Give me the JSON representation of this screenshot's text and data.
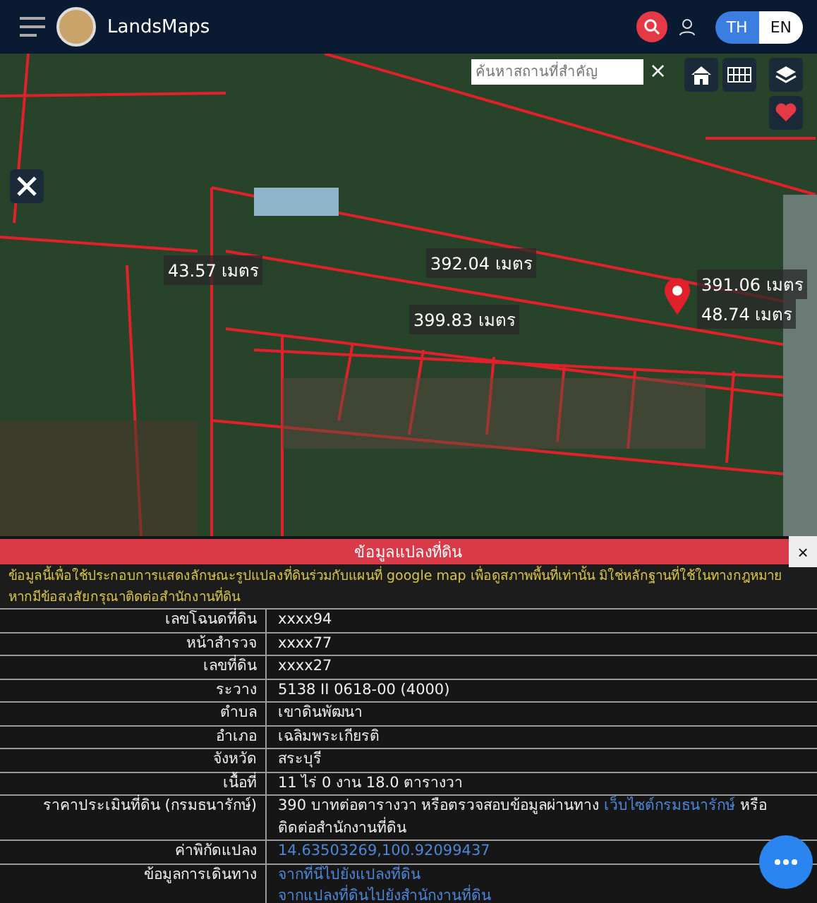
{
  "header": {
    "app_name": "LandsMaps",
    "languages": [
      {
        "label": "TH",
        "selected": true
      },
      {
        "label": "EN",
        "selected": false
      }
    ]
  },
  "map": {
    "search": {
      "placeholder": "ค้นหาสถานที่สำคัญ"
    },
    "close": "×",
    "measurements": [
      {
        "text": "43.57 เมตร"
      },
      {
        "text": "392.04 เมตร"
      },
      {
        "text": "399.83 เมตร"
      },
      {
        "text": "391.06 เมตร"
      },
      {
        "text": "48.74 เมตร"
      }
    ]
  },
  "panel": {
    "title": "ข้อมูลแปลงที่ดิน",
    "close": "×",
    "disclaimer": "ข้อมูลนี้เพื่อใช้ประกอบการแสดงลักษณะรูปแปลงที่ดินร่วมกับแผนที่ google map เพื่อดูสภาพพื้นที่เท่านั้น มิใช่หลักฐานที่ใช้ในทางกฎหมาย หากมีข้อสงสัยกรุณาติดต่อสำนักงานที่ดิน",
    "rows": [
      {
        "label": "เลขโฉนดที่ดิน",
        "lines": [
          [
            {
              "kind": "text",
              "text": "xxxx94"
            }
          ]
        ]
      },
      {
        "label": "หน้าสำรวจ",
        "lines": [
          [
            {
              "kind": "text",
              "text": "xxxx77"
            }
          ]
        ]
      },
      {
        "label": "เลขที่ดิน",
        "lines": [
          [
            {
              "kind": "text",
              "text": "xxxx27"
            }
          ]
        ]
      },
      {
        "label": "ระวาง",
        "lines": [
          [
            {
              "kind": "text",
              "text": "5138 II 0618-00 (4000)"
            }
          ]
        ]
      },
      {
        "label": "ตำบล",
        "lines": [
          [
            {
              "kind": "text",
              "text": "เขาดินพัฒนา"
            }
          ]
        ]
      },
      {
        "label": "อำเภอ",
        "lines": [
          [
            {
              "kind": "text",
              "text": "เฉลิมพระเกียรติ"
            }
          ]
        ]
      },
      {
        "label": "จังหวัด",
        "lines": [
          [
            {
              "kind": "text",
              "text": "สระบุรี"
            }
          ]
        ]
      },
      {
        "label": "เนื้อที่",
        "lines": [
          [
            {
              "kind": "text",
              "text": "11 ไร่ 0 งาน 18.0 ตารางวา"
            }
          ]
        ]
      },
      {
        "label": "ราคาประเมินที่ดิน (กรมธนารักษ์)",
        "lines": [
          [
            {
              "kind": "text",
              "text": "390 บาทต่อตารางวา หรือตรวจสอบข้อมูลผ่านทาง "
            },
            {
              "kind": "link",
              "text": "เว็บไซต์กรมธนารักษ์"
            },
            {
              "kind": "text",
              "text": " หรือติดต่อสำนักงานที่ดิน"
            }
          ]
        ]
      },
      {
        "label": "ค่าพิกัดแปลง",
        "lines": [
          [
            {
              "kind": "link",
              "text": "14.63503269,100.92099437"
            }
          ]
        ]
      },
      {
        "label": "ข้อมูลการเดินทาง",
        "lines": [
          [
            {
              "kind": "link",
              "text": "จากที่นี่ไปยังแปลงที่ดิน"
            }
          ],
          [
            {
              "kind": "link",
              "text": "จากแปลงที่ดินไปยังสำนักงานที่ดิน"
            }
          ]
        ]
      }
    ]
  }
}
